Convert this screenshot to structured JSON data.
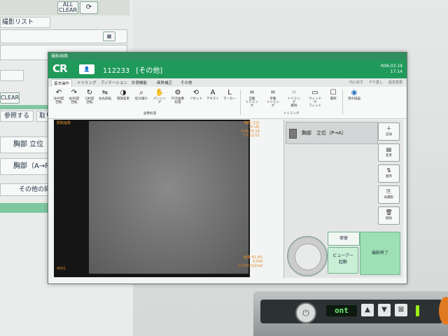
{
  "background_window": {
    "buttons": [
      {
        "label": "ALL\nCLEAR"
      },
      {
        "label": "⟳"
      }
    ],
    "tab": "撮影リスト",
    "clear": "CLEAR",
    "row_buttons": [
      {
        "label": "参照する"
      },
      {
        "label": "取り"
      }
    ],
    "rows": [
      {
        "text": "胸部 立位（P"
      },
      {
        "text": "胸部（A→P）"
      }
    ],
    "footer": "その他の撮影"
  },
  "window": {
    "title": "撮影画面",
    "logo": "CR",
    "patient_id": "112233",
    "patient_type": "[その他]",
    "date": "R06.03.19",
    "time": "17:14",
    "menus": [
      "基本操作",
      "トリミング",
      "アノテーション",
      "計測機能",
      "画質補正",
      "その他"
    ],
    "toolbar_right": [
      "元に戻す",
      "やり直し",
      "設定変更"
    ],
    "tools": [
      {
        "icon": "↶",
        "label": "左90度\n回転"
      },
      {
        "icon": "↷",
        "label": "右90度\n回転"
      },
      {
        "icon": "↻",
        "label": "180度\n回転"
      },
      {
        "icon": "⇋",
        "label": "左右反転"
      },
      {
        "icon": "◑",
        "label": "階調変更"
      },
      {
        "icon": "⌕",
        "label": "拡大縮小"
      },
      {
        "icon": "✋",
        "label": "パンニング"
      },
      {
        "icon": "⚙",
        "label": "PCR画像\n処理"
      },
      {
        "icon": "⟲",
        "label": "リセット"
      },
      {
        "icon": "A",
        "label": "テキスト"
      },
      {
        "icon": "L",
        "label": "マーカー"
      },
      {
        "icon": "⌗",
        "label": "自動\nトリミング"
      },
      {
        "icon": "⌗",
        "label": "手動\nトリミング"
      },
      {
        "icon": "⌗",
        "label": "トリミング\n解除"
      },
      {
        "icon": "▭",
        "label": "ウィンドウ\nフィット"
      },
      {
        "icon": "☐",
        "label": "選択"
      },
      {
        "icon": "◉",
        "label": "黒の描画"
      }
    ],
    "groups": [
      "画像処理",
      "トリミング"
    ],
    "image": {
      "label": "脱転画像",
      "exam": "胸部 立位(P→A)",
      "datetime": "R06.03.19 17:12:52",
      "stat1": "線量 41.9%",
      "stat2": "S:930",
      "stat3": "0.20mm/pixel",
      "id": "A001"
    },
    "panel": {
      "item_label": "胸部　立位（P→A）",
      "side_buttons": [
        {
          "icon": "＋",
          "label": "追加"
        },
        {
          "icon": "▤",
          "label": "変更"
        },
        {
          "icon": "⇅",
          "label": "順序"
        },
        {
          "icon": "⎘",
          "label": "再撮影"
        },
        {
          "icon": "🗑",
          "label": "削除"
        }
      ],
      "hold": "保留",
      "viewer": "ビューアー\n起動",
      "finish": "撮影終了"
    }
  },
  "device": {
    "lcd": "ont",
    "icons": [
      "▲",
      "▼",
      "⊠"
    ]
  }
}
